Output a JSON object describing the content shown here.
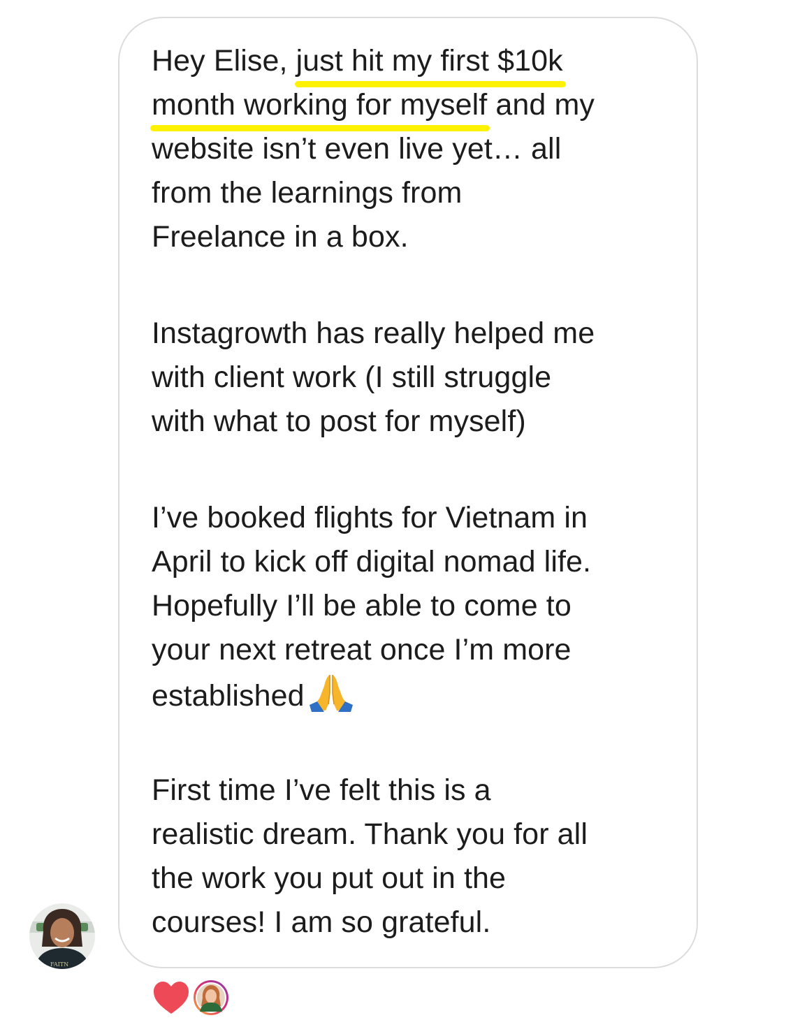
{
  "message": {
    "paragraph1": {
      "line1_prefix": "Hey Elise, ",
      "line1_highlight": "just hit my first $10k",
      "line2_highlight": "month working for myself",
      "line2_suffix": " and my",
      "line3": "website isn’t even live yet… all",
      "line4": "from the learnings from",
      "line5": "Freelance in a box."
    },
    "paragraph2": [
      "Instagrowth has really helped me",
      "with client work (I still struggle",
      "with what to post for myself)"
    ],
    "paragraph3": {
      "lines": [
        "I’ve booked flights for Vietnam in",
        "April to kick off digital nomad life.",
        "Hopefully I’ll be able to come to",
        "your next retreat once I’m more"
      ],
      "last_line": "established",
      "emoji": "folded-hands-emoji"
    },
    "paragraph4": [
      "First time I’ve felt this is a",
      "realistic dream. Thank you for all",
      "the work you put out in the",
      "courses! I am so grateful."
    ]
  },
  "sender": {
    "avatar_icon": "sender-avatar"
  },
  "reactions": [
    {
      "icon": "heart-icon",
      "color": "#ed4956"
    },
    {
      "icon": "reactor-avatar"
    }
  ],
  "colors": {
    "highlight": "#fff200",
    "bubble_border": "#dcdcdc",
    "text": "#1c1c1c"
  }
}
